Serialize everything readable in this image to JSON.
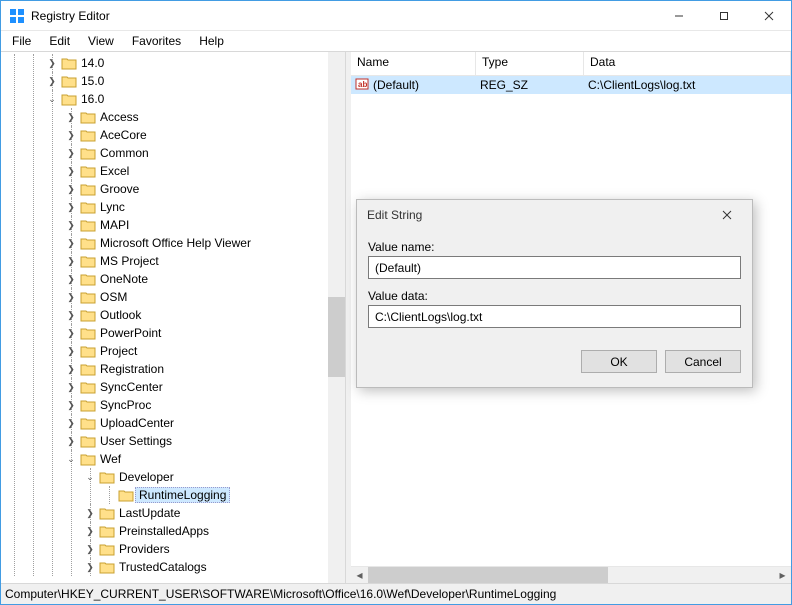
{
  "window": {
    "title": "Registry Editor"
  },
  "menu": {
    "file": "File",
    "edit": "Edit",
    "view": "View",
    "favorites": "Favorites",
    "help": "Help"
  },
  "list": {
    "headers": {
      "name": "Name",
      "type": "Type",
      "data": "Data"
    },
    "rows": [
      {
        "name": "(Default)",
        "type": "REG_SZ",
        "data": "C:\\ClientLogs\\log.txt"
      }
    ]
  },
  "tree": {
    "n14": "14.0",
    "n15": "15.0",
    "n16": "16.0",
    "children16": {
      "access": "Access",
      "acecore": "AceCore",
      "common": "Common",
      "excel": "Excel",
      "groove": "Groove",
      "lync": "Lync",
      "mapi": "MAPI",
      "mohv": "Microsoft Office Help Viewer",
      "msproject": "MS Project",
      "onenote": "OneNote",
      "osm": "OSM",
      "outlook": "Outlook",
      "powerpoint": "PowerPoint",
      "project": "Project",
      "registration": "Registration",
      "synccenter": "SyncCenter",
      "syncproc": "SyncProc",
      "uploadcenter": "UploadCenter",
      "usersettings": "User Settings",
      "wef": "Wef"
    },
    "wef": {
      "developer": "Developer",
      "runtimelogging": "RuntimeLogging",
      "lastupdate": "LastUpdate",
      "preinstalledapps": "PreinstalledApps",
      "providers": "Providers",
      "trustedcatalogs": "TrustedCatalogs"
    }
  },
  "dialog": {
    "title": "Edit String",
    "value_name_label": "Value name:",
    "value_name": "(Default)",
    "value_data_label": "Value data:",
    "value_data": "C:\\ClientLogs\\log.txt",
    "ok": "OK",
    "cancel": "Cancel"
  },
  "status": "Computer\\HKEY_CURRENT_USER\\SOFTWARE\\Microsoft\\Office\\16.0\\Wef\\Developer\\RuntimeLogging"
}
